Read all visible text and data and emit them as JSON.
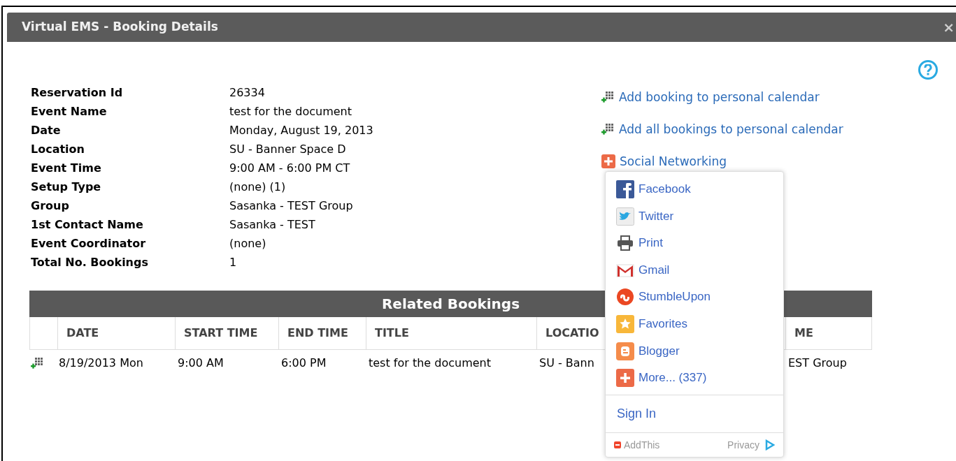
{
  "window": {
    "title": "Virtual EMS - Booking Details",
    "close": "×"
  },
  "details": [
    {
      "label": "Reservation Id",
      "value": "26334"
    },
    {
      "label": "Event Name",
      "value": "test for the document"
    },
    {
      "label": "Date",
      "value": "Monday, August 19, 2013"
    },
    {
      "label": "Location",
      "value": "SU - Banner Space D"
    },
    {
      "label": "Event Time",
      "value": "9:00 AM - 6:00 PM CT"
    },
    {
      "label": "Setup Type",
      "value": "(none) (1)"
    },
    {
      "label": "Group",
      "value": "Sasanka - TEST Group"
    },
    {
      "label": "1st Contact Name",
      "value": "Sasanka - TEST"
    },
    {
      "label": "Event Coordinator",
      "value": "(none)"
    },
    {
      "label": "Total No. Bookings",
      "value": "1"
    }
  ],
  "actions": [
    {
      "label": "Add booking to personal calendar",
      "kind": "calendar"
    },
    {
      "label": "Add all bookings to personal calendar",
      "kind": "calendar"
    },
    {
      "label": "Social Networking",
      "kind": "share"
    }
  ],
  "share_menu": {
    "items": [
      {
        "label": "Facebook",
        "kind": "facebook"
      },
      {
        "label": "Twitter",
        "kind": "twitter"
      },
      {
        "label": "Print",
        "kind": "print"
      },
      {
        "label": "Gmail",
        "kind": "gmail"
      },
      {
        "label": "StumbleUpon",
        "kind": "stumbleupon"
      },
      {
        "label": "Favorites",
        "kind": "favorites"
      },
      {
        "label": "Blogger",
        "kind": "blogger"
      },
      {
        "label": "More... (337)",
        "kind": "more"
      }
    ],
    "sign_in": "Sign In",
    "brand": "AddThis",
    "privacy": "Privacy"
  },
  "related": {
    "title": "Related Bookings",
    "columns": [
      "DATE",
      "START TIME",
      "END TIME",
      "TITLE",
      "LOCATIO",
      "ME"
    ],
    "rows": [
      {
        "cells": [
          "8/19/2013 Mon",
          "9:00 AM",
          "6:00 PM",
          "test for the document",
          "SU - Bann",
          "EST Group"
        ]
      }
    ]
  }
}
